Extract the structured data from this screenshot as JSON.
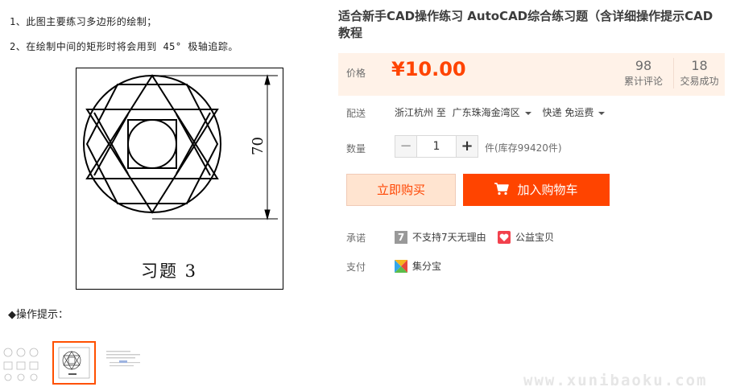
{
  "image": {
    "notes": [
      "1、此图主要练习多边形的绘制；",
      "2、在绘制中间的矩形时将会用到 45° 极轴追踪。"
    ],
    "dimension_label": "70",
    "exercise_title": "习题  3",
    "tips_label": "◆操作提示："
  },
  "product": {
    "title": "适合新手CAD操作练习 AutoCAD综合练习题（含详细操作提示CAD教程",
    "price_label": "价格",
    "price": "¥10.00",
    "reviews_count": "98",
    "reviews_label": "累计评论",
    "sales_count": "18",
    "sales_label": "交易成功"
  },
  "delivery": {
    "label": "配送",
    "from": "浙江杭州 至",
    "to": "广东珠海金湾区",
    "method": "快递 免运费"
  },
  "quantity": {
    "label": "数量",
    "minus": "−",
    "value": "1",
    "plus": "+",
    "stock": "件(库存99420件)"
  },
  "buttons": {
    "buy_now": "立即购买",
    "add_to_cart": "加入购物车"
  },
  "promise": {
    "label": "承诺",
    "items": [
      "不支持7天无理由",
      "公益宝贝"
    ],
    "icon_text": "7"
  },
  "payment": {
    "label": "支付",
    "method": "集分宝"
  },
  "watermark": "www.xunibaoku.com",
  "colors": {
    "accent": "#ff4400",
    "price_bg": "#fff2e8",
    "buy_bg": "#ffe4d0"
  },
  "icons": [
    "cart-icon",
    "no-return-7-icon",
    "charity-icon",
    "jifenbao-icon",
    "caret-down-icon"
  ]
}
